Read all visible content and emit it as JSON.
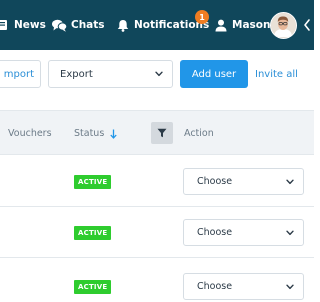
{
  "nav": {
    "news_label": "News",
    "chats_label": "Chats",
    "notifications_label": "Notifications",
    "notifications_count": "1",
    "user_name": "Mason",
    "background_color": "#10475b",
    "badge_color": "#ef7d22"
  },
  "toolbar": {
    "import_label": "mport",
    "export_value": "Export",
    "add_user_label": "Add user",
    "invite_all_label": "Invite all",
    "primary_color": "#2196e8"
  },
  "table": {
    "headers": {
      "vouchers": "Vouchers",
      "status": "Status",
      "action": "Action"
    },
    "rows": [
      {
        "status": "ACTIVE",
        "action_value": "Choose"
      },
      {
        "status": "ACTIVE",
        "action_value": "Choose"
      },
      {
        "status": "ACTIVE",
        "action_value": "Choose"
      }
    ],
    "status_color": "#2ecc2e"
  },
  "icons": {
    "news": "newspaper-icon",
    "chats": "chat-bubbles-icon",
    "notifications": "bell-icon",
    "user": "user-icon",
    "sort": "arrow-down-icon",
    "filter": "funnel-icon",
    "dropdown": "chevron-down-icon"
  }
}
